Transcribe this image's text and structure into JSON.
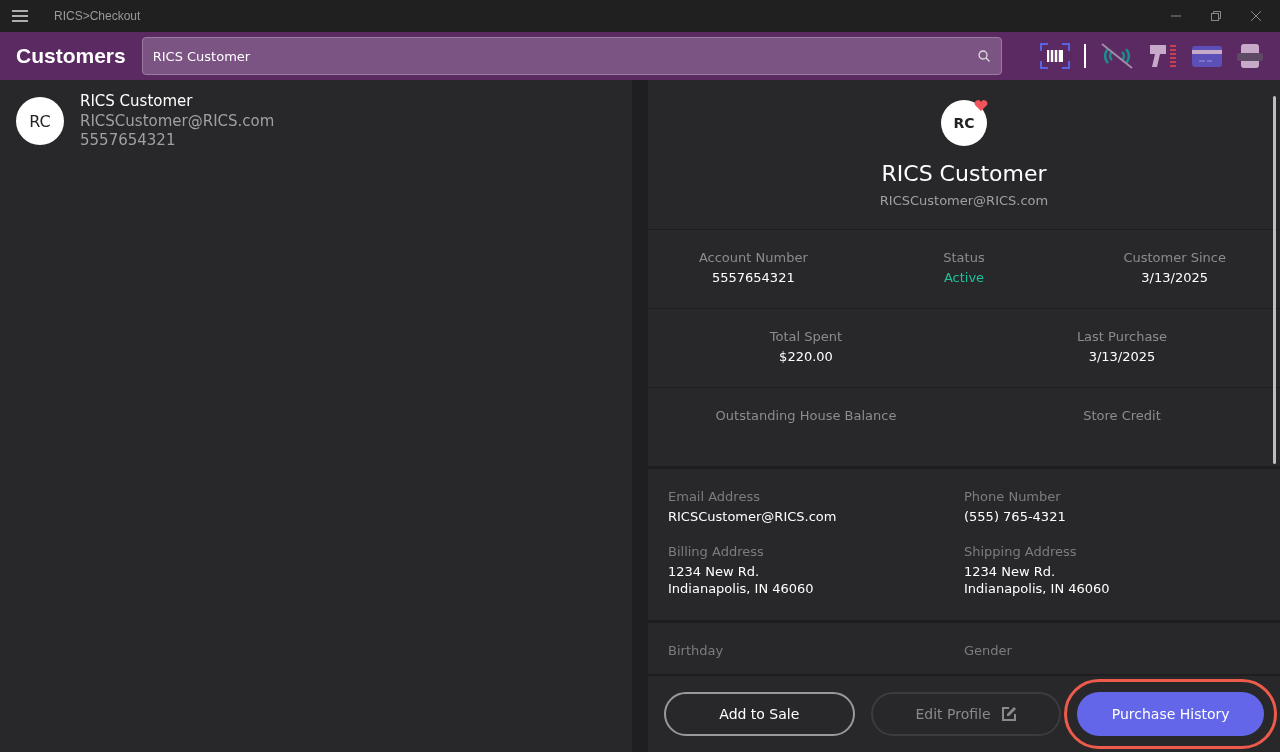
{
  "window": {
    "title": "RICS>Checkout"
  },
  "header": {
    "title": "Customers",
    "search": {
      "value": "RICS Customer"
    }
  },
  "toolbar_icons": [
    {
      "kind": "barcode"
    },
    {
      "kind": "divider"
    },
    {
      "kind": "signal-off"
    },
    {
      "kind": "scanner"
    },
    {
      "kind": "card"
    },
    {
      "kind": "printer"
    }
  ],
  "results": [
    {
      "initials": "RC",
      "name": "RICS Customer",
      "email": "RICSCustomer@RICS.com",
      "phone": "5557654321"
    }
  ],
  "profile": {
    "initials": "RC",
    "favorite": true,
    "name": "RICS Customer",
    "email": "RICSCustomer@RICS.com",
    "stat_rows": [
      [
        {
          "label": "Account Number",
          "value": "5557654321",
          "color": "#ffffff"
        },
        {
          "label": "Status",
          "value": "Active",
          "color": "#1fc29a"
        },
        {
          "label": "Customer Since",
          "value": "3/13/2025",
          "color": "#ffffff"
        }
      ],
      [
        {
          "label": "Total Spent",
          "value": "$220.00",
          "color": "#ffffff"
        },
        {
          "label": "Last Purchase",
          "value": "3/13/2025",
          "color": "#ffffff"
        }
      ],
      [
        {
          "label": "Outstanding House Balance"
        },
        {
          "label": "Store Credit"
        }
      ]
    ],
    "detail_groups": [
      [
        {
          "label": "Email Address",
          "lines": [
            "RICSCustomer@RICS.com"
          ]
        },
        {
          "label": "Phone Number",
          "lines": [
            "(555) 765-4321"
          ]
        },
        {
          "label": "Billing Address",
          "lines": [
            "1234 New Rd.",
            "Indianapolis, IN 46060"
          ]
        },
        {
          "label": "Shipping Address",
          "lines": [
            "1234 New Rd.",
            "Indianapolis, IN 46060"
          ]
        }
      ],
      [
        {
          "label": "Birthday"
        },
        {
          "label": "Gender"
        }
      ]
    ]
  },
  "actions": [
    {
      "label": "Add to Sale",
      "kind": "outline",
      "disabled": false,
      "highlighted": false
    },
    {
      "label": "Edit Profile",
      "kind": "outline-icon",
      "disabled": true,
      "highlighted": false
    },
    {
      "label": "Purchase History",
      "kind": "primary",
      "disabled": false,
      "highlighted": true
    }
  ]
}
